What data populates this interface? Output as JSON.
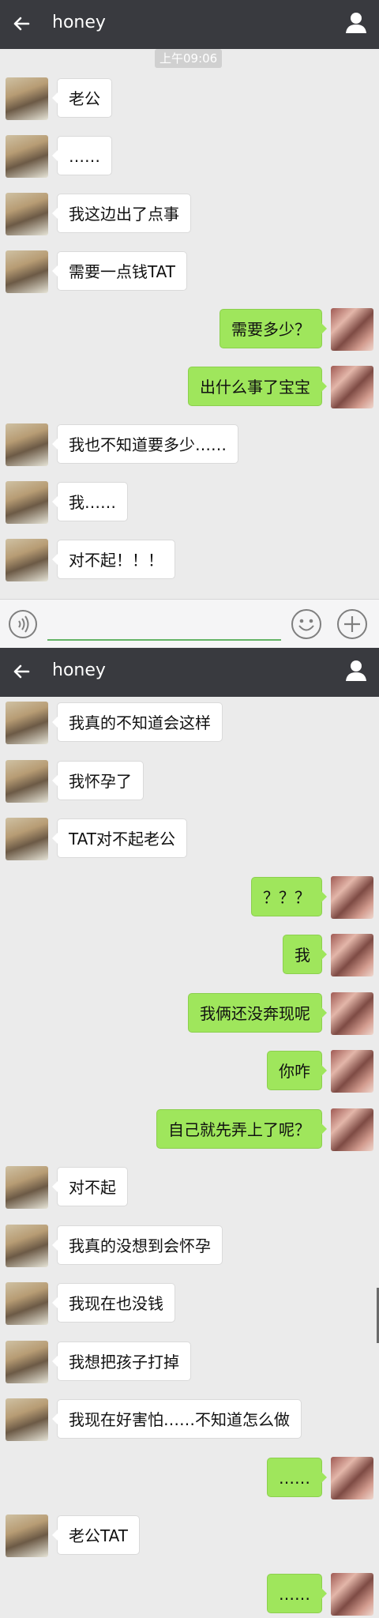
{
  "contact_name": "honey",
  "timestamp": "上午09:06",
  "icons": {
    "back": "back-arrow-icon",
    "person": "person-icon",
    "voice": "voice-icon",
    "emoji": "emoji-icon",
    "plus": "plus-icon"
  },
  "colors": {
    "topbar": "#393a3f",
    "sent_bubble": "#9fe65c",
    "received_bubble": "#ffffff",
    "background": "#ebebeb"
  },
  "screen1": {
    "messages": [
      {
        "side": "left",
        "text": "老公"
      },
      {
        "side": "left",
        "text": "……"
      },
      {
        "side": "left",
        "text": "我这边出了点事"
      },
      {
        "side": "left",
        "text": "需要一点钱TAT"
      },
      {
        "side": "right",
        "text": "需要多少？"
      },
      {
        "side": "right",
        "text": "出什么事了宝宝"
      },
      {
        "side": "left",
        "text": "我也不知道要多少……"
      },
      {
        "side": "left",
        "text": "我……"
      },
      {
        "side": "left",
        "text": "对不起！！！"
      }
    ]
  },
  "screen2": {
    "messages": [
      {
        "side": "left",
        "text": "我真的不知道会这样"
      },
      {
        "side": "left",
        "text": "我怀孕了"
      },
      {
        "side": "left",
        "text": "TAT对不起老公"
      },
      {
        "side": "right",
        "text": "？？？"
      },
      {
        "side": "right",
        "text": "我"
      },
      {
        "side": "right",
        "text": "我俩还没奔现呢"
      },
      {
        "side": "right",
        "text": "你咋"
      },
      {
        "side": "right",
        "text": "自己就先弄上了呢？"
      },
      {
        "side": "left",
        "text": "对不起"
      },
      {
        "side": "left",
        "text": "我真的没想到会怀孕"
      },
      {
        "side": "left",
        "text": "我现在也没钱"
      },
      {
        "side": "left",
        "text": "我想把孩子打掉"
      },
      {
        "side": "left",
        "text": "我现在好害怕……不知道怎么做"
      },
      {
        "side": "right",
        "text": "……"
      },
      {
        "side": "left",
        "text": "老公TAT"
      },
      {
        "side": "right",
        "text": "……"
      }
    ]
  }
}
